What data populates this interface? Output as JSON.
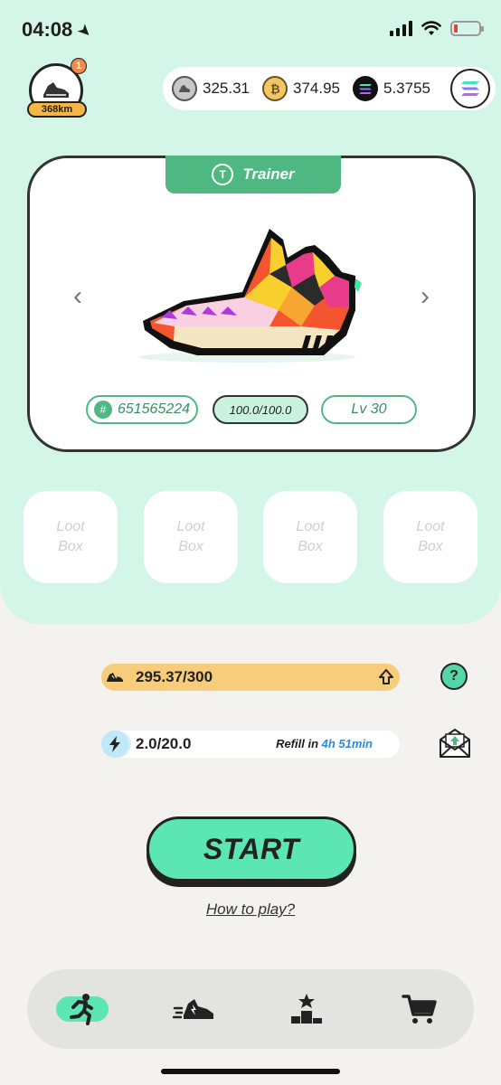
{
  "status": {
    "time": "04:08"
  },
  "profile": {
    "badge": "1",
    "distance": "368km"
  },
  "balances": {
    "gst": "325.31",
    "gmt": "374.95",
    "sol": "5.3755"
  },
  "sneaker": {
    "type": "Trainer",
    "id": "651565224",
    "durability": "100.0/100.0",
    "level": "Lv 30"
  },
  "loot_boxes": [
    {
      "label_1": "Loot",
      "label_2": "Box"
    },
    {
      "label_1": "Loot",
      "label_2": "Box"
    },
    {
      "label_1": "Loot",
      "label_2": "Box"
    },
    {
      "label_1": "Loot",
      "label_2": "Box"
    }
  ],
  "stats": {
    "energy_value": "295.37/300",
    "energy_fraction": 0.985,
    "refill_value": "2.0/20.0",
    "refill_fraction": 0.1,
    "refill_label": "Refill in",
    "refill_time": "4h 51min"
  },
  "actions": {
    "start": "START",
    "how_to_play": "How to play?"
  },
  "colors": {
    "accent": "#5ce6b3",
    "header_bg": "#d4f6e9",
    "trainer_green": "#4fb882"
  },
  "tabs": [
    {
      "icon": "running-person-icon",
      "active": true
    },
    {
      "icon": "sneaker-icon",
      "active": false
    },
    {
      "icon": "podium-icon",
      "active": false
    },
    {
      "icon": "cart-icon",
      "active": false
    }
  ]
}
